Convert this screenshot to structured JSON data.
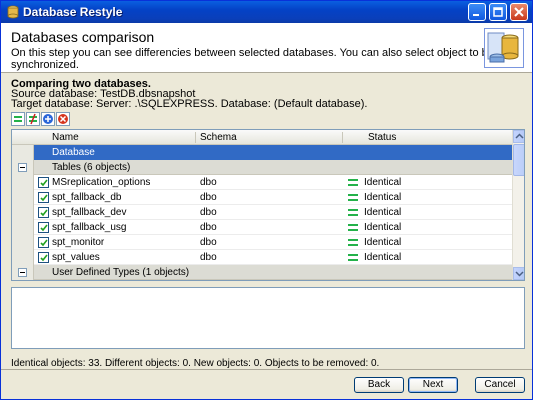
{
  "window": {
    "title": "Database Restyle"
  },
  "header": {
    "title": "Databases comparison",
    "subtitle": "On this step you can see differencies between selected databases. You can also select object to be synchronized."
  },
  "info": {
    "heading": "Comparing two databases.",
    "source": "Source database: TestDB.dbsnapshot",
    "target": "Target database: Server: .\\SQLEXPRESS. Database: (Default database)."
  },
  "grid": {
    "columns": {
      "name": "Name",
      "schema": "Schema",
      "status": "Status"
    },
    "database_label": "Database",
    "groups": [
      {
        "label": "Tables (6 objects)"
      },
      {
        "label": "User Defined Types (1 objects)"
      }
    ],
    "items": [
      {
        "name": "MSreplication_options",
        "schema": "dbo",
        "status": "Identical"
      },
      {
        "name": "spt_fallback_db",
        "schema": "dbo",
        "status": "Identical"
      },
      {
        "name": "spt_fallback_dev",
        "schema": "dbo",
        "status": "Identical"
      },
      {
        "name": "spt_fallback_usg",
        "schema": "dbo",
        "status": "Identical"
      },
      {
        "name": "spt_monitor",
        "schema": "dbo",
        "status": "Identical"
      },
      {
        "name": "spt_values",
        "schema": "dbo",
        "status": "Identical"
      }
    ]
  },
  "status_text": "Identical objects: 33.  Different objects: 0.  New objects: 0.  Objects to be removed: 0.",
  "buttons": {
    "back": "Back",
    "next": "Next",
    "cancel": "Cancel"
  },
  "colors": {
    "identical": "#24b24a",
    "selection": "#316ac5"
  }
}
